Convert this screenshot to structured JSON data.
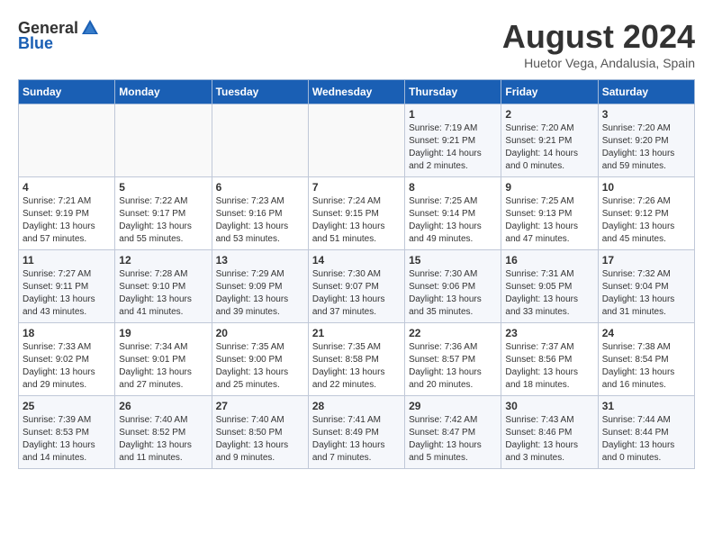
{
  "header": {
    "logo_general": "General",
    "logo_blue": "Blue",
    "month_year": "August 2024",
    "location": "Huetor Vega, Andalusia, Spain"
  },
  "weekdays": [
    "Sunday",
    "Monday",
    "Tuesday",
    "Wednesday",
    "Thursday",
    "Friday",
    "Saturday"
  ],
  "weeks": [
    [
      {
        "day": "",
        "info": ""
      },
      {
        "day": "",
        "info": ""
      },
      {
        "day": "",
        "info": ""
      },
      {
        "day": "",
        "info": ""
      },
      {
        "day": "1",
        "info": "Sunrise: 7:19 AM\nSunset: 9:21 PM\nDaylight: 14 hours\nand 2 minutes."
      },
      {
        "day": "2",
        "info": "Sunrise: 7:20 AM\nSunset: 9:21 PM\nDaylight: 14 hours\nand 0 minutes."
      },
      {
        "day": "3",
        "info": "Sunrise: 7:20 AM\nSunset: 9:20 PM\nDaylight: 13 hours\nand 59 minutes."
      }
    ],
    [
      {
        "day": "4",
        "info": "Sunrise: 7:21 AM\nSunset: 9:19 PM\nDaylight: 13 hours\nand 57 minutes."
      },
      {
        "day": "5",
        "info": "Sunrise: 7:22 AM\nSunset: 9:17 PM\nDaylight: 13 hours\nand 55 minutes."
      },
      {
        "day": "6",
        "info": "Sunrise: 7:23 AM\nSunset: 9:16 PM\nDaylight: 13 hours\nand 53 minutes."
      },
      {
        "day": "7",
        "info": "Sunrise: 7:24 AM\nSunset: 9:15 PM\nDaylight: 13 hours\nand 51 minutes."
      },
      {
        "day": "8",
        "info": "Sunrise: 7:25 AM\nSunset: 9:14 PM\nDaylight: 13 hours\nand 49 minutes."
      },
      {
        "day": "9",
        "info": "Sunrise: 7:25 AM\nSunset: 9:13 PM\nDaylight: 13 hours\nand 47 minutes."
      },
      {
        "day": "10",
        "info": "Sunrise: 7:26 AM\nSunset: 9:12 PM\nDaylight: 13 hours\nand 45 minutes."
      }
    ],
    [
      {
        "day": "11",
        "info": "Sunrise: 7:27 AM\nSunset: 9:11 PM\nDaylight: 13 hours\nand 43 minutes."
      },
      {
        "day": "12",
        "info": "Sunrise: 7:28 AM\nSunset: 9:10 PM\nDaylight: 13 hours\nand 41 minutes."
      },
      {
        "day": "13",
        "info": "Sunrise: 7:29 AM\nSunset: 9:09 PM\nDaylight: 13 hours\nand 39 minutes."
      },
      {
        "day": "14",
        "info": "Sunrise: 7:30 AM\nSunset: 9:07 PM\nDaylight: 13 hours\nand 37 minutes."
      },
      {
        "day": "15",
        "info": "Sunrise: 7:30 AM\nSunset: 9:06 PM\nDaylight: 13 hours\nand 35 minutes."
      },
      {
        "day": "16",
        "info": "Sunrise: 7:31 AM\nSunset: 9:05 PM\nDaylight: 13 hours\nand 33 minutes."
      },
      {
        "day": "17",
        "info": "Sunrise: 7:32 AM\nSunset: 9:04 PM\nDaylight: 13 hours\nand 31 minutes."
      }
    ],
    [
      {
        "day": "18",
        "info": "Sunrise: 7:33 AM\nSunset: 9:02 PM\nDaylight: 13 hours\nand 29 minutes."
      },
      {
        "day": "19",
        "info": "Sunrise: 7:34 AM\nSunset: 9:01 PM\nDaylight: 13 hours\nand 27 minutes."
      },
      {
        "day": "20",
        "info": "Sunrise: 7:35 AM\nSunset: 9:00 PM\nDaylight: 13 hours\nand 25 minutes."
      },
      {
        "day": "21",
        "info": "Sunrise: 7:35 AM\nSunset: 8:58 PM\nDaylight: 13 hours\nand 22 minutes."
      },
      {
        "day": "22",
        "info": "Sunrise: 7:36 AM\nSunset: 8:57 PM\nDaylight: 13 hours\nand 20 minutes."
      },
      {
        "day": "23",
        "info": "Sunrise: 7:37 AM\nSunset: 8:56 PM\nDaylight: 13 hours\nand 18 minutes."
      },
      {
        "day": "24",
        "info": "Sunrise: 7:38 AM\nSunset: 8:54 PM\nDaylight: 13 hours\nand 16 minutes."
      }
    ],
    [
      {
        "day": "25",
        "info": "Sunrise: 7:39 AM\nSunset: 8:53 PM\nDaylight: 13 hours\nand 14 minutes."
      },
      {
        "day": "26",
        "info": "Sunrise: 7:40 AM\nSunset: 8:52 PM\nDaylight: 13 hours\nand 11 minutes."
      },
      {
        "day": "27",
        "info": "Sunrise: 7:40 AM\nSunset: 8:50 PM\nDaylight: 13 hours\nand 9 minutes."
      },
      {
        "day": "28",
        "info": "Sunrise: 7:41 AM\nSunset: 8:49 PM\nDaylight: 13 hours\nand 7 minutes."
      },
      {
        "day": "29",
        "info": "Sunrise: 7:42 AM\nSunset: 8:47 PM\nDaylight: 13 hours\nand 5 minutes."
      },
      {
        "day": "30",
        "info": "Sunrise: 7:43 AM\nSunset: 8:46 PM\nDaylight: 13 hours\nand 3 minutes."
      },
      {
        "day": "31",
        "info": "Sunrise: 7:44 AM\nSunset: 8:44 PM\nDaylight: 13 hours\nand 0 minutes."
      }
    ]
  ]
}
